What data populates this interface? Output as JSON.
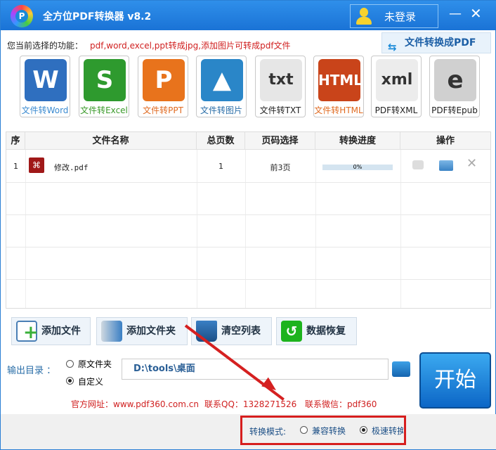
{
  "window": {
    "title": "全方位PDF转换器 v8.2",
    "logo_letter": "P",
    "login_label": "未登录",
    "minimize": "—",
    "close": "✕"
  },
  "current": {
    "label": "您当前选择的功能：",
    "value": "pdf,word,excel,ppt转成jpg,添加图片可转成pdf文件"
  },
  "to_pdf_button": "文件转换成PDF",
  "functions": [
    {
      "label": "文件转Word",
      "icon": "W",
      "color": "#2f6fbf",
      "text_color": "#3a8ad0"
    },
    {
      "label": "文件转Excel",
      "icon": "S",
      "color": "#2e9a2e",
      "text_color": "#3a9a2a"
    },
    {
      "label": "文件转PPT",
      "icon": "P",
      "color": "#e8731c",
      "text_color": "#e06a20"
    },
    {
      "label": "文件转图片",
      "icon": "▲",
      "color": "#2a86c8",
      "text_color": "#2a6ea8"
    },
    {
      "label": "文件转TXT",
      "icon": "txt",
      "color": "#e6e6e6",
      "text_color": "#222"
    },
    {
      "label": "文件转HTML",
      "icon": "HTML",
      "color": "#c9441a",
      "text_color": "#e06a20"
    },
    {
      "label": "PDF转XML",
      "icon": "xml",
      "color": "#ececec",
      "text_color": "#222"
    },
    {
      "label": "PDF转Epub",
      "icon": "e",
      "color": "#d0d0d0",
      "text_color": "#222"
    }
  ],
  "table": {
    "headers": [
      "序",
      "文件名称",
      "总页数",
      "页码选择",
      "转换进度",
      "操作"
    ],
    "rows": [
      {
        "index": "1",
        "name": "修改.pdf",
        "pages": "1",
        "range": "前3页",
        "progress_text": "0%",
        "progress": 0
      }
    ]
  },
  "actions": [
    "添加文件",
    "添加文件夹",
    "清空列表",
    "数据恢复"
  ],
  "output": {
    "label": "输出目录 ：",
    "option1": "原文件夹",
    "option2": "自定义",
    "selected": "自定义",
    "path": "D:\\tools\\桌面"
  },
  "start_button": "开始",
  "contact": {
    "site": "官方网址：www.pdf360.com.cn",
    "qq": "联系QQ：1328271526",
    "wechat": "联系微信：pdf360"
  },
  "mode": {
    "label": "转换模式:",
    "option1": "兼容转换",
    "option2": "极速转换",
    "selected": "极速转换"
  }
}
